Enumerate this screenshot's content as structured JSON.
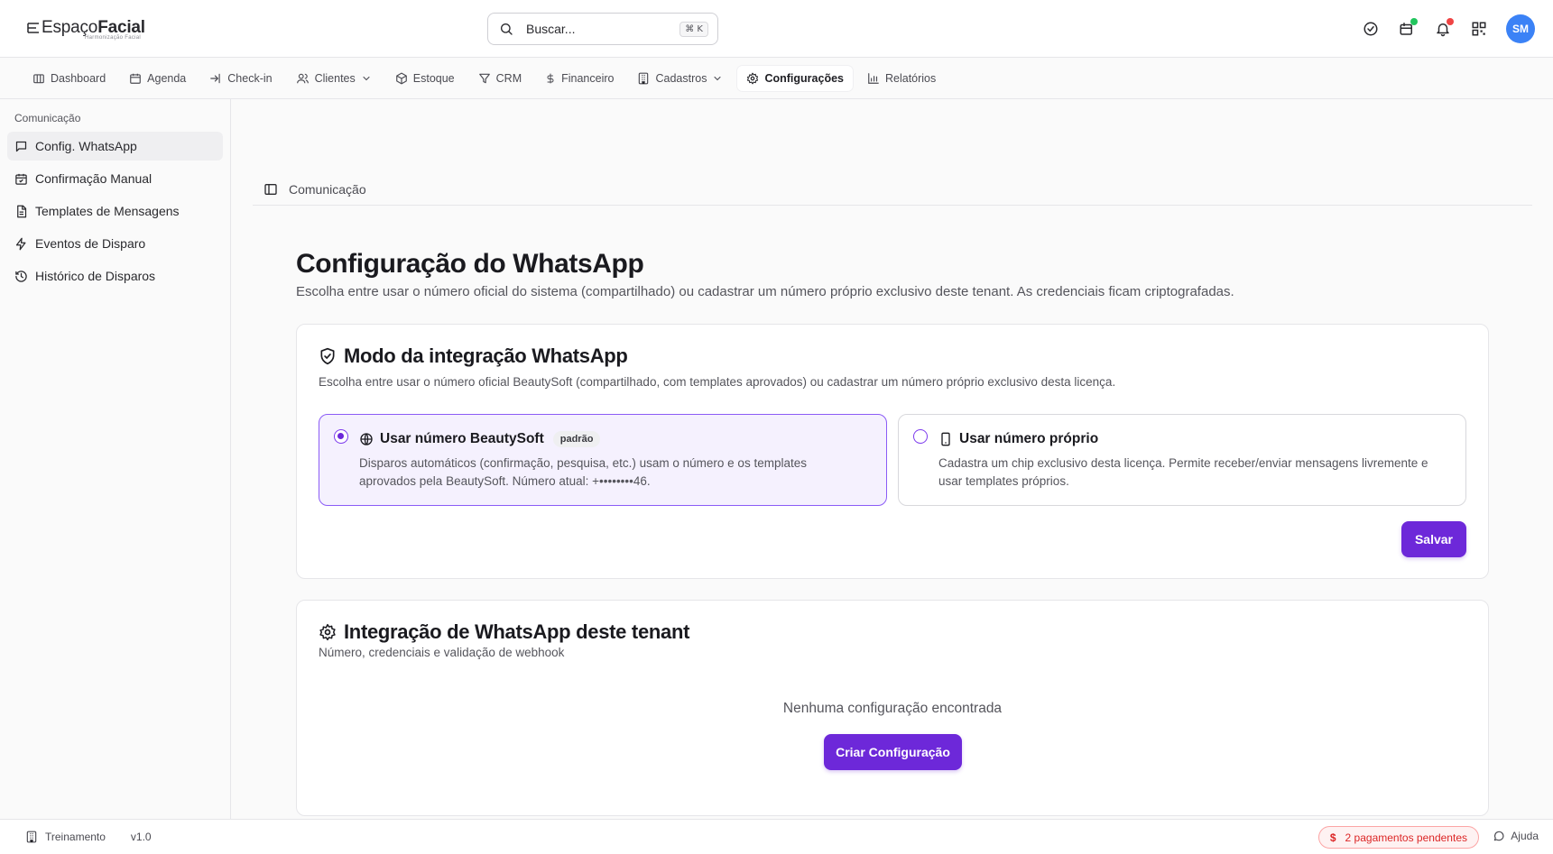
{
  "brand": {
    "name_light": "Espaço",
    "name_bold": "Facial",
    "tagline": "Harmonização Facial"
  },
  "search": {
    "placeholder": "Buscar...",
    "shortcut": "⌘ K"
  },
  "header_icons": [
    "check-circle-icon",
    "calendar-notify-icon",
    "bell-icon",
    "qr-code-icon"
  ],
  "user": {
    "initials": "SM",
    "avatar_color": "#3b82f6"
  },
  "nav": [
    {
      "label": "Dashboard",
      "icon": "dashboard-icon"
    },
    {
      "label": "Agenda",
      "icon": "calendar-icon"
    },
    {
      "label": "Check-in",
      "icon": "login-icon"
    },
    {
      "label": "Clientes",
      "icon": "users-icon",
      "dropdown": true
    },
    {
      "label": "Estoque",
      "icon": "package-icon"
    },
    {
      "label": "CRM",
      "icon": "filter-icon"
    },
    {
      "label": "Financeiro",
      "icon": "dollar-icon"
    },
    {
      "label": "Cadastros",
      "icon": "building-icon",
      "dropdown": true
    },
    {
      "label": "Configurações",
      "icon": "gear-icon",
      "active": true
    },
    {
      "label": "Relatórios",
      "icon": "bar-chart-icon"
    }
  ],
  "sidebar": {
    "group": "Comunicação",
    "items": [
      {
        "label": "Config. WhatsApp",
        "icon": "message-icon",
        "active": true
      },
      {
        "label": "Confirmação Manual",
        "icon": "calendar-check-icon"
      },
      {
        "label": "Templates de Mensagens",
        "icon": "file-text-icon"
      },
      {
        "label": "Eventos de Disparo",
        "icon": "zap-icon"
      },
      {
        "label": "Histórico de Disparos",
        "icon": "history-icon"
      }
    ]
  },
  "breadcrumb": {
    "label": "Comunicação"
  },
  "page": {
    "title": "Configuração do WhatsApp",
    "description": "Escolha entre usar o número oficial do sistema (compartilhado) ou cadastrar um número próprio exclusivo deste tenant. As credenciais ficam criptografadas."
  },
  "mode_card": {
    "title": "Modo da integração WhatsApp",
    "description": "Escolha entre usar o número oficial BeautySoft (compartilhado, com templates aprovados) ou cadastrar um número próprio exclusivo desta licença.",
    "options": [
      {
        "title": "Usar número BeautySoft",
        "badge": "padrão",
        "description": "Disparos automáticos (confirmação, pesquisa, etc.) usam o número e os templates aprovados pela BeautySoft. Número atual: +••••••••46.",
        "selected": true
      },
      {
        "title": "Usar número próprio",
        "description": "Cadastra um chip exclusivo desta licença. Permite receber/enviar mensagens livremente e usar templates próprios.",
        "selected": false
      }
    ],
    "save_label": "Salvar"
  },
  "integration_card": {
    "title": "Integração de WhatsApp deste tenant",
    "description": "Número, credenciais e validação de webhook",
    "empty_text": "Nenhuma configuração encontrada",
    "create_label": "Criar Configuração"
  },
  "footer": {
    "environment": "Treinamento",
    "version": "v1.0",
    "pending_icon": "$",
    "pending_label": "2 pagamentos pendentes",
    "help_label": "Ajuda"
  },
  "colors": {
    "accent": "#6d28d9",
    "accent_soft": "#f5f1fe",
    "danger": "#dc2626",
    "success": "#22c55e"
  }
}
